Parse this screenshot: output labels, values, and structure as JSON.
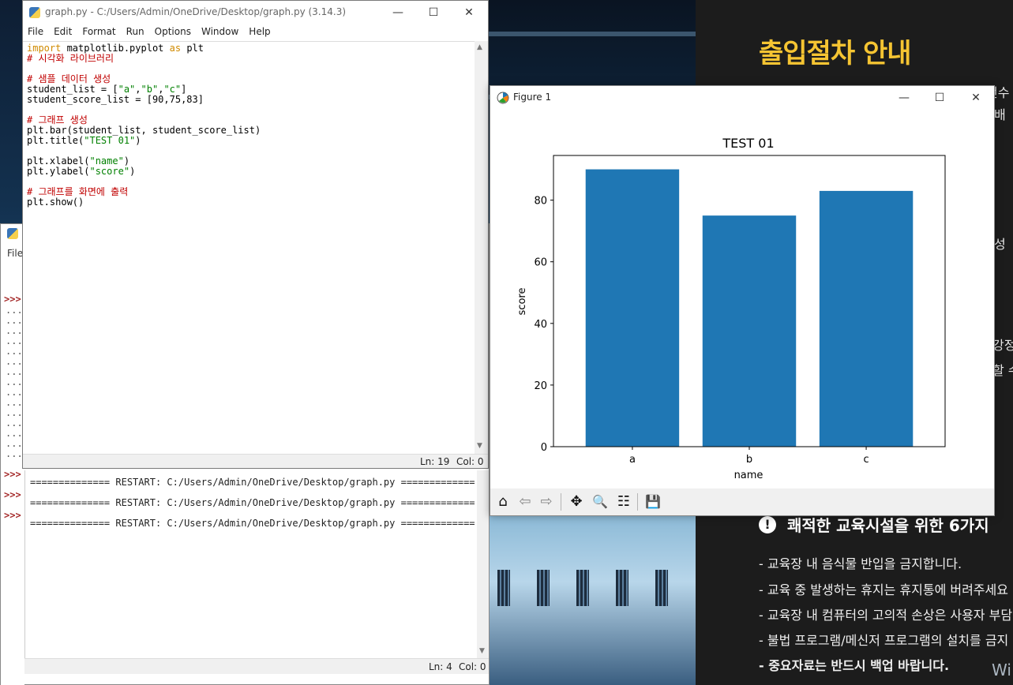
{
  "desktop": {
    "poster_title": "출입절차 안내",
    "poster_fragments": [
      "전수",
      "배",
      "성",
      "강정",
      "할 수"
    ],
    "subhead": "쾌적한 교육시설을 위한 6가지",
    "subhead_icon": "exclamation-icon",
    "rules": [
      "-  교육장 내 음식물 반입을 금지합니다.",
      "-  교육 중 발생하는 휴지는 휴지통에 버려주세요",
      "-  교육장 내 컴퓨터의 고의적 손상은 사용자 부담",
      "-  불법 프로그램/메신저 프로그램의 설치를 금지",
      "-  중요자료는 반드시 백업 바랍니다."
    ],
    "watermark": "Wi"
  },
  "shell": {
    "menu_label": "File",
    "prompts": [
      ">>>",
      ">>>",
      ">>>",
      ">>>"
    ],
    "continuation": "...",
    "restart_lines": [
      "============== RESTART: C:/Users/Admin/OneDrive/Desktop/graph.py =============",
      "============== RESTART: C:/Users/Admin/OneDrive/Desktop/graph.py =============",
      "============== RESTART: C:/Users/Admin/OneDrive/Desktop/graph.py ============="
    ],
    "status_ln": "Ln: 4",
    "status_col": "Col: 0"
  },
  "editor": {
    "title": "graph.py - C:/Users/Admin/OneDrive/Desktop/graph.py (3.14.3)",
    "menu": [
      "File",
      "Edit",
      "Format",
      "Run",
      "Options",
      "Window",
      "Help"
    ],
    "window_buttons": {
      "minimize": "—",
      "maximize": "☐",
      "close": "✕"
    },
    "code": {
      "l1_kw1": "import",
      "l1_mid": " matplotlib.pyplot ",
      "l1_kw2": "as",
      "l1_end": " plt",
      "l2": "# 시각화 라이브러리",
      "l4": "# 샘플 데이터 생성",
      "l5_a": "student_list = [",
      "l5_s1": "\"a\"",
      "l5_c1": ",",
      "l5_s2": "\"b\"",
      "l5_c2": ",",
      "l5_s3": "\"c\"",
      "l5_b": "]",
      "l6": "student_score_list = [90,75,83]",
      "l8": "# 그래프 생성",
      "l9": "plt.bar(student_list, student_score_list)",
      "l10_a": "plt.title(",
      "l10_s": "\"TEST 01\"",
      "l10_b": ")",
      "l12_a": "plt.xlabel(",
      "l12_s": "\"name\"",
      "l12_b": ")",
      "l13_a": "plt.ylabel(",
      "l13_s": "\"score\"",
      "l13_b": ")",
      "l15": "# 그래프를 화면에 출력",
      "l16": "plt.show()"
    },
    "status_ln": "Ln: 19",
    "status_col": "Col: 0"
  },
  "figure": {
    "title": "Figure 1",
    "window_buttons": {
      "minimize": "—",
      "maximize": "☐",
      "close": "✕"
    },
    "toolbar": {
      "home": "⌂",
      "back": "⇦",
      "forward": "⇨",
      "pan": "✥",
      "zoom": "🔍",
      "configure": "☷",
      "save": "💾"
    }
  },
  "chart_data": {
    "type": "bar",
    "title": "TEST 01",
    "xlabel": "name",
    "ylabel": "score",
    "categories": [
      "a",
      "b",
      "c"
    ],
    "values": [
      90,
      75,
      83
    ],
    "ylim": [
      0,
      94.5
    ],
    "yticks": [
      0,
      20,
      40,
      60,
      80
    ],
    "bar_color": "#1f77b4",
    "grid": false,
    "legend": "none"
  }
}
